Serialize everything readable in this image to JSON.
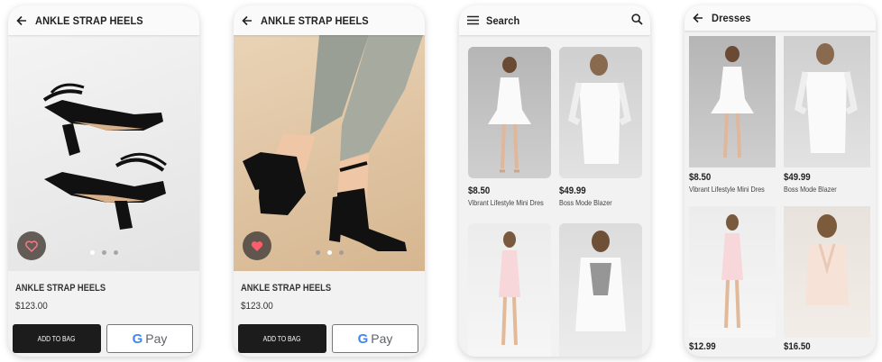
{
  "screens": [
    {
      "title": "ANKLE STRAP HEELS",
      "product_name": "ANKLE STRAP HEELS",
      "price": "$123.00",
      "add_to_bag": "ADD TO BAG",
      "gpay_g": "G",
      "gpay_label": "Pay",
      "carousel_active_index": 0,
      "carousel_count": 3
    },
    {
      "title": "ANKLE STRAP HEELS",
      "product_name": "ANKLE STRAP HEELS",
      "price": "$123.00",
      "add_to_bag": "ADD TO BAG",
      "gpay_g": "G",
      "gpay_label": "Pay",
      "carousel_active_index": 1,
      "carousel_count": 3
    },
    {
      "title": "Search",
      "items": [
        {
          "price": "$8.50",
          "name": "Vibrant Lifestyle Mini Dres"
        },
        {
          "price": "$49.99",
          "name": "Boss Mode Blazer"
        },
        {
          "price": "",
          "name": ""
        },
        {
          "price": "",
          "name": ""
        }
      ]
    },
    {
      "title": "Dresses",
      "items": [
        {
          "price": "$8.50",
          "name": "Vibrant Lifestyle Mini Dres"
        },
        {
          "price": "$49.99",
          "name": "Boss Mode Blazer"
        },
        {
          "price": "$12.99",
          "name": ""
        },
        {
          "price": "$16.50",
          "name": ""
        }
      ]
    }
  ],
  "icons": {
    "back": "arrow-left-icon",
    "menu": "hamburger-menu-icon",
    "search": "search-icon",
    "favorite": "heart-icon"
  },
  "colors": {
    "primary_button": "#1c1c1c",
    "favorite_fill_active": "#ff5c6c",
    "favorite_outline": "#ff7b86",
    "google_blue": "#4285f4"
  }
}
